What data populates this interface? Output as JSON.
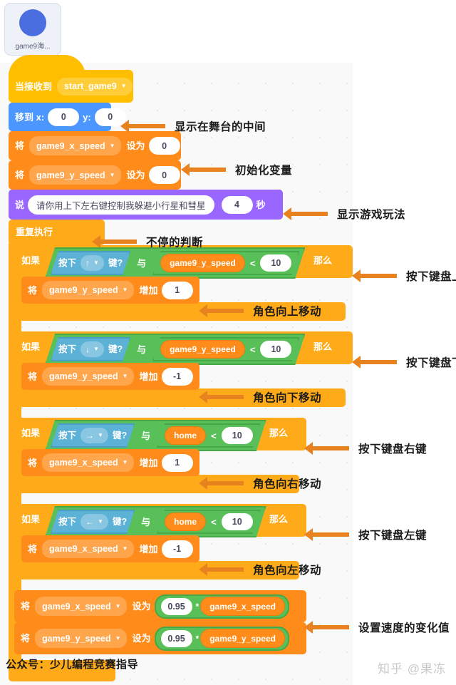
{
  "sprite": {
    "label": "game9海...",
    "icon": "circle-sprite-icon",
    "color": "#4a6ee0"
  },
  "script": {
    "hat": {
      "label": "当接收到",
      "message": "start_game9",
      "caret": "▼"
    },
    "goto": {
      "label": "移到 x:",
      "x": "0",
      "y_label": "y:",
      "y": "0"
    },
    "set_x_init": {
      "label": "将",
      "variable": "game9_x_speed",
      "to_label": "设为",
      "value": "0",
      "caret": "▼"
    },
    "set_y_init": {
      "label": "将",
      "variable": "game9_y_speed",
      "to_label": "设为",
      "value": "0",
      "caret": "▼"
    },
    "say": {
      "label": "说",
      "message": "请你用上下左右键控制我躲避小行星和彗星",
      "seconds": "4",
      "seconds_label": "秒"
    },
    "forever": {
      "label": "重复执行"
    },
    "if_blocks": [
      {
        "if_label": "如果",
        "then_label": "那么",
        "press_label": "按下",
        "key": "↑",
        "key_suffix": "键?",
        "caret": "▼",
        "and_label": "与",
        "left_operand": "game9_y_speed",
        "operator": "<",
        "right_operand": "10",
        "body": {
          "label": "将",
          "variable": "game9_y_speed",
          "change_label": "增加",
          "value": "1",
          "caret": "▼"
        }
      },
      {
        "if_label": "如果",
        "then_label": "那么",
        "press_label": "按下",
        "key": "↓",
        "key_suffix": "键?",
        "caret": "▼",
        "and_label": "与",
        "left_operand": "game9_y_speed",
        "operator": "<",
        "right_operand": "10",
        "body": {
          "label": "将",
          "variable": "game9_y_speed",
          "change_label": "增加",
          "value": "-1",
          "caret": "▼"
        }
      },
      {
        "if_label": "如果",
        "then_label": "那么",
        "press_label": "按下",
        "key": "→",
        "key_suffix": "键?",
        "caret": "▼",
        "and_label": "与",
        "left_operand": "home",
        "operator": "<",
        "right_operand": "10",
        "body": {
          "label": "将",
          "variable": "game9_x_speed",
          "change_label": "增加",
          "value": "1",
          "caret": "▼"
        }
      },
      {
        "if_label": "如果",
        "then_label": "那么",
        "press_label": "按下",
        "key": "←",
        "key_suffix": "键?",
        "caret": "▼",
        "and_label": "与",
        "left_operand": "home",
        "operator": "<",
        "right_operand": "10",
        "body": {
          "label": "将",
          "variable": "game9_x_speed",
          "change_label": "增加",
          "value": "-1",
          "caret": "▼"
        }
      }
    ],
    "damp_x": {
      "label": "将",
      "variable": "game9_x_speed",
      "to_label": "设为",
      "factor": "0.95",
      "star": "*",
      "operand": "game9_x_speed",
      "caret": "▼"
    },
    "damp_y": {
      "label": "将",
      "variable": "game9_y_speed",
      "to_label": "设为",
      "factor": "0.95",
      "star": "*",
      "operand": "game9_y_speed",
      "caret": "▼"
    }
  },
  "annotations": [
    {
      "text": "显示在舞台的中间"
    },
    {
      "text": "初始化变量"
    },
    {
      "text": "显示游戏玩法"
    },
    {
      "text": "不停的判断"
    },
    {
      "text": "按下键盘上键"
    },
    {
      "text": "角色向上移动"
    },
    {
      "text": "按下键盘下键"
    },
    {
      "text": "角色向下移动"
    },
    {
      "text": "按下键盘右键"
    },
    {
      "text": "角色向右移动"
    },
    {
      "text": "按下键盘左键"
    },
    {
      "text": "角色向左移动"
    },
    {
      "text": "设置速度的变化值"
    }
  ],
  "footer": {
    "note": "公众号：少儿编程竞赛指导",
    "watermark": "知乎 @果冻"
  },
  "colors": {
    "event": "#ffbf00",
    "motion": "#4c97ff",
    "variable": "#ff8c1a",
    "looks": "#9966ff",
    "control": "#ffab19",
    "operator": "#59c059",
    "sensing": "#5cb1d6",
    "annotation": "#e8821e"
  }
}
